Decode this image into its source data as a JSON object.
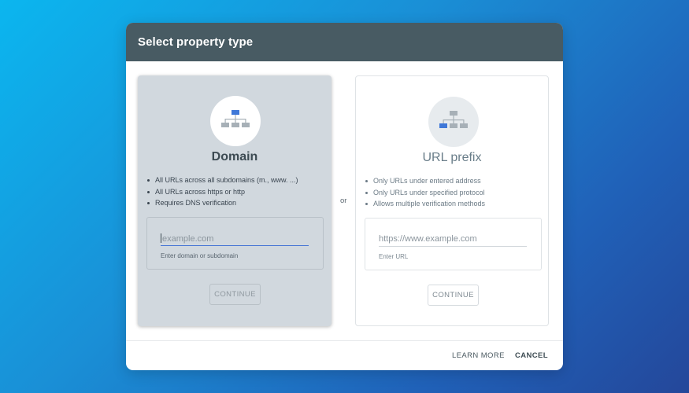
{
  "dialog": {
    "title": "Select property type",
    "separator": "or",
    "footer": {
      "learn_more_label": "LEARN MORE",
      "cancel_label": "CANCEL"
    }
  },
  "domain_card": {
    "title": "Domain",
    "icon": "sitemap-icon",
    "bullets": [
      "All URLs across all subdomains (m., www. ...)",
      "All URLs across https or http",
      "Requires DNS verification"
    ],
    "input": {
      "value": "",
      "placeholder": "example.com",
      "helper": "Enter domain or subdomain"
    },
    "continue_label": "CONTINUE"
  },
  "url_card": {
    "title": "URL prefix",
    "icon": "sitemap-icon",
    "bullets": [
      "Only URLs under entered address",
      "Only URLs under specified protocol",
      "Allows multiple verification methods"
    ],
    "input": {
      "value": "",
      "placeholder": "https://www.example.com",
      "helper": "Enter URL"
    },
    "continue_label": "CONTINUE"
  },
  "colors": {
    "header_bg": "#485b63",
    "accent_blue": "#4574d4",
    "selected_card_bg": "#d1d8de"
  }
}
